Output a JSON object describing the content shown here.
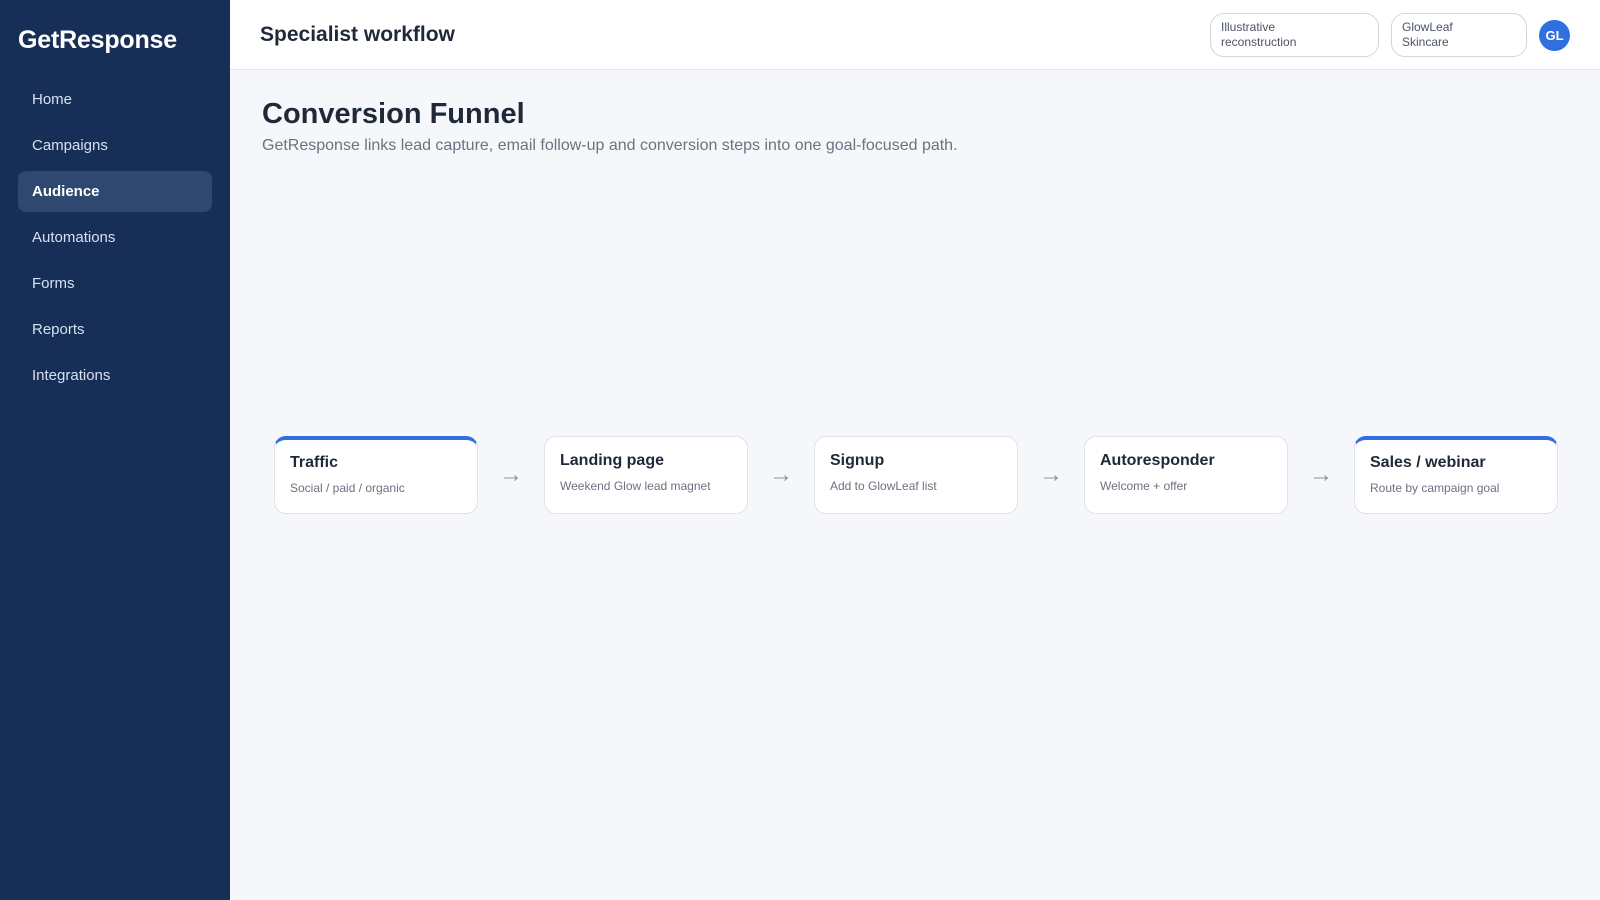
{
  "sidebar": {
    "brand": "GetResponse",
    "items": [
      {
        "label": "Home"
      },
      {
        "label": "Campaigns"
      },
      {
        "label": "Audience"
      },
      {
        "label": "Automations"
      },
      {
        "label": "Forms"
      },
      {
        "label": "Reports"
      },
      {
        "label": "Integrations"
      }
    ],
    "active_index": 2
  },
  "topbar": {
    "title": "Specialist workflow",
    "pill1": {
      "line1": "Illustrative",
      "line2": "reconstruction"
    },
    "pill2": {
      "line1": "GlowLeaf",
      "line2": "Skincare"
    },
    "avatar": "GL"
  },
  "page": {
    "title": "Conversion Funnel",
    "subtitle": "GetResponse links lead capture, email follow-up and conversion steps into one goal-focused path."
  },
  "funnel": {
    "steps": [
      {
        "name": "Traffic",
        "desc": "Social / paid / organic"
      },
      {
        "name": "Landing page",
        "desc": "Weekend Glow lead magnet"
      },
      {
        "name": "Signup",
        "desc": "Add to GlowLeaf list"
      },
      {
        "name": "Autoresponder",
        "desc": "Welcome + offer"
      },
      {
        "name": "Sales / webinar",
        "desc": "Route by campaign goal"
      }
    ],
    "arrow": "→"
  },
  "colors": {
    "sidebar_bg": "#172f57",
    "accent": "#2f6fe0",
    "page_bg": "#f5f7fb"
  }
}
